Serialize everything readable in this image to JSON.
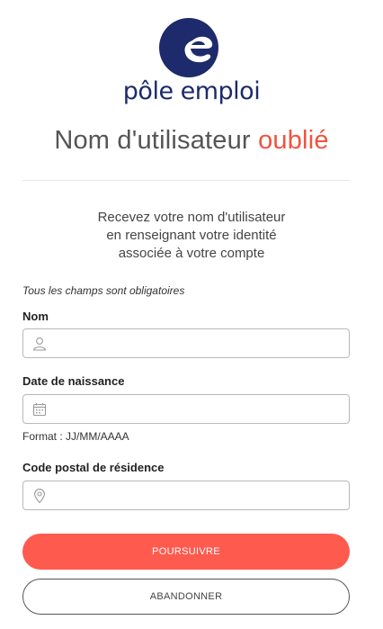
{
  "brand": {
    "name": "pôle emploi",
    "primary_color": "#1d2a6b",
    "logo_icon": "pole-emploi-e-logo"
  },
  "page": {
    "title_main": "Nom d'utilisateur",
    "title_accent": "oublié",
    "accent_color": "#f0533f",
    "intro_lines": [
      "Recevez votre nom d'utilisateur",
      "en renseignant votre identité",
      "associée à votre compte"
    ],
    "required_note": "Tous les champs sont obligatoires"
  },
  "form": {
    "nom": {
      "label": "Nom",
      "value": "",
      "icon": "user-icon"
    },
    "date_naissance": {
      "label": "Date de naissance",
      "value": "",
      "icon": "calendar-icon",
      "hint": "Format : JJ/MM/AAAA"
    },
    "code_postal": {
      "label": "Code postal de résidence",
      "value": "",
      "icon": "map-pin-icon"
    }
  },
  "actions": {
    "submit_label": "Poursuivre",
    "submit_color": "#ff5a4e",
    "cancel_label": "Abandonner"
  }
}
